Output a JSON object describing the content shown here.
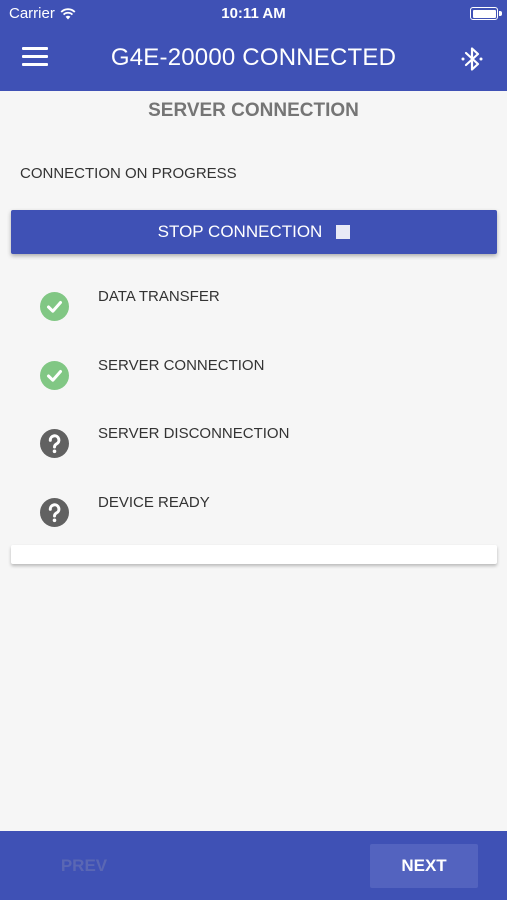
{
  "status_bar": {
    "carrier": "Carrier",
    "time": "10:11 AM",
    "wifi_icon": "wifi-icon",
    "battery_icon": "battery-icon"
  },
  "app_bar": {
    "title": "G4E-20000 CONNECTED",
    "menu_icon": "hamburger-menu-icon",
    "bluetooth_icon": "bluetooth-icon"
  },
  "section_title": "SERVER CONNECTION",
  "connection_status": "CONNECTION ON PROGRESS",
  "stop_button": {
    "label": "STOP CONNECTION",
    "icon": "stop-square-icon"
  },
  "steps": [
    {
      "label": "DATA TRANSFER",
      "state": "done",
      "icon": "check-circle-icon"
    },
    {
      "label": "SERVER CONNECTION",
      "state": "done",
      "icon": "check-circle-icon"
    },
    {
      "label": "SERVER DISCONNECTION",
      "state": "unknown",
      "icon": "question-circle-icon"
    },
    {
      "label": "DEVICE READY",
      "state": "unknown",
      "icon": "question-circle-icon"
    }
  ],
  "footer": {
    "prev_label": "PREV",
    "next_label": "NEXT"
  },
  "colors": {
    "primary": "#3f51b5",
    "success": "#81c784",
    "unknown": "#616161",
    "background": "#f6f6f6"
  }
}
